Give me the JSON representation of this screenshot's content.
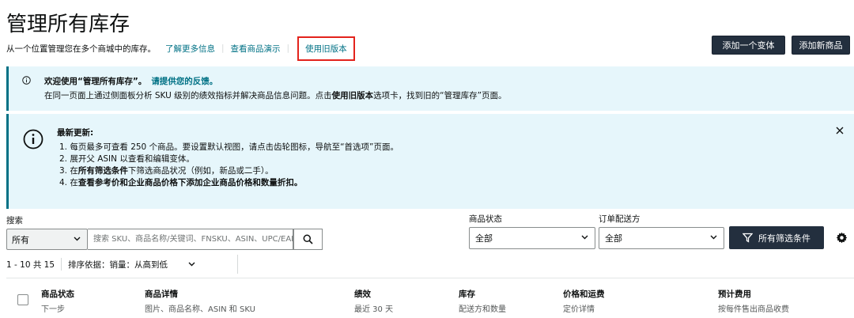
{
  "header": {
    "title": "管理所有库存",
    "subtitle": "从一个位置管理您在多个商城中的库存。",
    "learn_more": "了解更多信息",
    "view_demo": "查看商品演示",
    "legacy_version": "使用旧版本",
    "add_variant": "添加一个变体",
    "add_product": "添加新商品"
  },
  "banner_welcome": {
    "title": "欢迎使用“管理所有库存”。",
    "feedback": "请提供您的反馈。",
    "text_before": "在同一页面上通过侧面板分析 SKU 级别的绩效指标并解决商品信息问题。点击",
    "text_bold": "使用旧版本",
    "text_after": "选项卡，找到旧的“管理库存”页面。"
  },
  "banner_updates": {
    "title": "最新更新:",
    "item1": "1. 每页最多可查看 250 个商品。要设置默认视图，请点击齿轮图标，导航至“首选项”页面。",
    "item2": "2. 展开父 ASIN 以查看和编辑变体。",
    "item3_a": "3. 在",
    "item3_b": "所有筛选条件",
    "item3_c": "下筛选商品状况（例如，新品或二手）。",
    "item4_a": "4. 在",
    "item4_b": "查看参考价和企业商品价格下添加企业商品价格和数量折扣。"
  },
  "search": {
    "label": "搜索",
    "scope": "所有",
    "placeholder": "搜索 SKU、商品名称/关键词、FNSKU、ASIN、UPC/EAN"
  },
  "filters": {
    "status_label": "商品状态",
    "status_value": "全部",
    "fulfillment_label": "订单配送方",
    "fulfillment_value": "全部",
    "all_filters": "所有筛选条件"
  },
  "results": {
    "range": "1 - 10 共 15",
    "sort_label": "排序依据：销量：从高到低"
  },
  "table": {
    "columns": [
      {
        "title": "商品状态",
        "sub": "下一步"
      },
      {
        "title": "商品详情",
        "sub": "图片、商品名称、ASIN 和 SKU"
      },
      {
        "title": "绩效",
        "sub": "最近 30 天"
      },
      {
        "title": "库存",
        "sub": "配送方和数量"
      },
      {
        "title": "价格和运费",
        "sub": "定价详情"
      },
      {
        "title": "预计费用",
        "sub": "按每件售出商品收费"
      }
    ]
  },
  "colors": {
    "accent": "#007185",
    "dark_button": "#232f3e",
    "banner_bg": "#e6f6fb",
    "highlight_border": "#e3231c"
  }
}
